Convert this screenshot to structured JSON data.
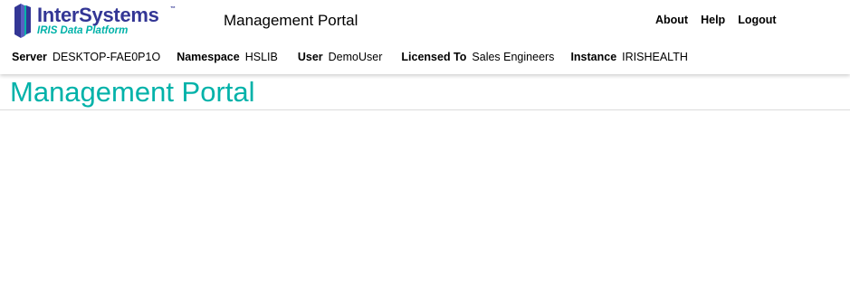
{
  "logo": {
    "brand": "InterSystems",
    "trademark": "™",
    "subtitle": "IRIS Data Platform",
    "icon": "intersystems-logo-icon"
  },
  "header": {
    "app_title": "Management Portal",
    "links": {
      "about": "About",
      "help": "Help",
      "logout": "Logout"
    }
  },
  "info": {
    "server_label": "Server",
    "server_value": "DESKTOP-FAE0P1O",
    "namespace_label": "Namespace",
    "namespace_value": "HSLIB",
    "user_label": "User",
    "user_value": "DemoUser",
    "licensed_label": "Licensed To",
    "licensed_value": "Sales Engineers",
    "instance_label": "Instance",
    "instance_value": "IRISHEALTH"
  },
  "main": {
    "page_title": "Management Portal"
  },
  "colors": {
    "brand_purple": "#333695",
    "accent_teal": "#00b2a9"
  }
}
